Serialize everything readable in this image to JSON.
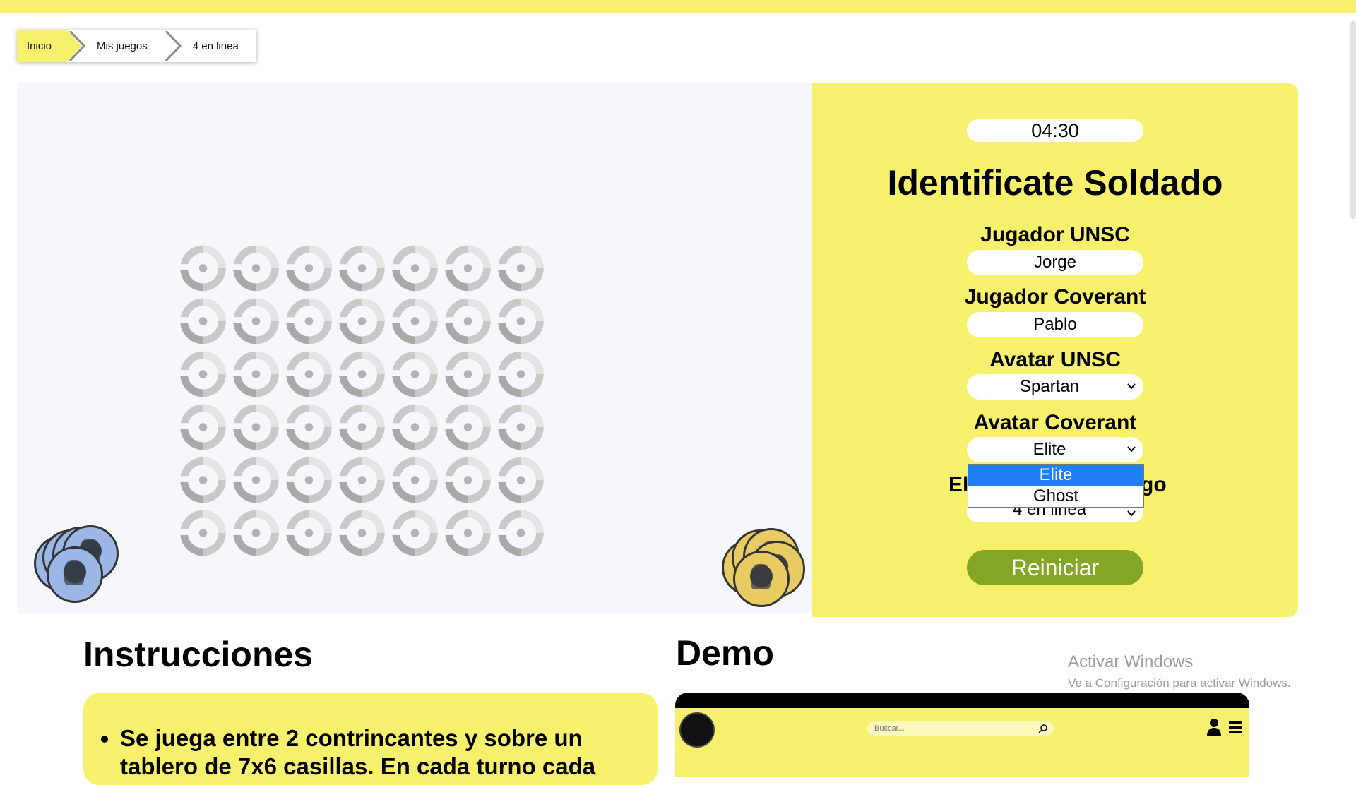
{
  "breadcrumb": {
    "items": [
      "Inicio",
      "Mis juegos",
      "4 en linea"
    ]
  },
  "board": {
    "columns": 7,
    "rows": 6
  },
  "panel": {
    "timer": "04:30",
    "title": "Identificate Soldado",
    "player1_label": "Jugador UNSC",
    "player1_value": "Jorge",
    "player2_label": "Jugador Coverant",
    "player2_value": "Pablo",
    "avatar1_label": "Avatar UNSC",
    "avatar1_value": "Spartan",
    "avatar2_label": "Avatar Coverant",
    "avatar2_value": "Elite",
    "mode_label_left": "El",
    "mode_label_right": "go",
    "mode_value": "4 en linea",
    "restart_label": "Reiniciar",
    "dropdown_options": [
      "Elite",
      "Ghost"
    ],
    "dropdown_selected": "Elite"
  },
  "instructions": {
    "title": "Instrucciones",
    "text": "Se juega entre 2 contrincantes y sobre un tablero de 7x6 casillas. En cada turno cada"
  },
  "demo": {
    "title": "Demo",
    "search_placeholder": "Buscar..."
  },
  "watermark": {
    "line1": "Activar Windows",
    "line2": "Ve a Configuración para activar Windows."
  },
  "colors": {
    "accent": "#f7f06d",
    "button": "#84a624",
    "selected_option": "#1e7ff7"
  },
  "icons": [
    "chevron-right-icon",
    "chevron-down-icon",
    "search-icon",
    "user-icon",
    "menu-icon",
    "hole-icon",
    "chip-icon"
  ]
}
